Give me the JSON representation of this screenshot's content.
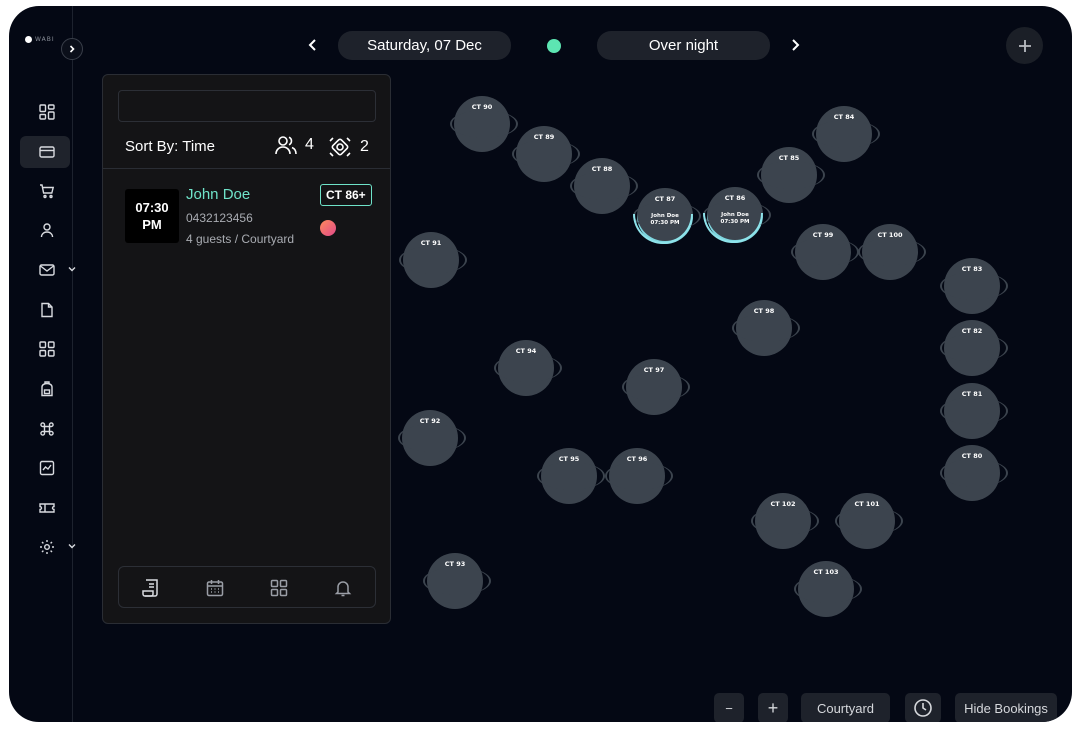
{
  "brand": {
    "logo_text": "WABI"
  },
  "header": {
    "date": "Saturday, 07 Dec",
    "shift": "Over night",
    "status_color": "#5de5b2"
  },
  "sidebar": {
    "items": [
      {
        "icon": "dashboard-icon",
        "active": false
      },
      {
        "icon": "card-icon",
        "active": true
      },
      {
        "icon": "cart-icon",
        "active": false
      },
      {
        "icon": "user-icon",
        "active": false
      },
      {
        "icon": "mail-icon",
        "active": false,
        "expandable": true
      },
      {
        "icon": "document-icon",
        "active": false
      },
      {
        "icon": "grid-icon",
        "active": false
      },
      {
        "icon": "backpack-icon",
        "active": false
      },
      {
        "icon": "command-icon",
        "active": false
      },
      {
        "icon": "report-icon",
        "active": false
      },
      {
        "icon": "ticket-icon",
        "active": false
      },
      {
        "icon": "gear-icon",
        "active": false,
        "expandable": true
      }
    ]
  },
  "panel": {
    "search": {
      "value": "",
      "placeholder": ""
    },
    "sort_label": "Sort By: Time",
    "guest_count": "4",
    "table_count": "2",
    "bookings": [
      {
        "time": "07:30 PM",
        "time_line1": "07:30",
        "time_line2": "PM",
        "name": "John Doe",
        "phone": "0432123456",
        "detail": "4 guests / Courtyard",
        "table": "CT 86+"
      }
    ],
    "tabs": [
      "list-tab",
      "calendar-tab",
      "grid-tab",
      "bell-tab"
    ]
  },
  "floor": {
    "tables": [
      {
        "label": "CT 90"
      },
      {
        "label": "CT 89"
      },
      {
        "label": "CT 88"
      },
      {
        "label": "CT 87",
        "booked": true,
        "booking_name": "John Doe",
        "booking_time": "07:30 PM"
      },
      {
        "label": "CT 86",
        "booked": true,
        "booking_name": "John Doe",
        "booking_time": "07:30 PM"
      },
      {
        "label": "CT 85"
      },
      {
        "label": "CT 84"
      },
      {
        "label": "CT 91"
      },
      {
        "label": "CT 99"
      },
      {
        "label": "CT 100"
      },
      {
        "label": "CT 83"
      },
      {
        "label": "CT 98"
      },
      {
        "label": "CT 82"
      },
      {
        "label": "CT 94"
      },
      {
        "label": "CT 97"
      },
      {
        "label": "CT 81"
      },
      {
        "label": "CT 92"
      },
      {
        "label": "CT 95"
      },
      {
        "label": "CT 96"
      },
      {
        "label": "CT 80"
      },
      {
        "label": "CT 102"
      },
      {
        "label": "CT 101"
      },
      {
        "label": "CT 103"
      },
      {
        "label": "CT 93"
      }
    ]
  },
  "bottom_bar": {
    "zoom_out": "−",
    "zoom_in": "+",
    "area": "Courtyard",
    "hide_bookings": "Hide Bookings"
  }
}
